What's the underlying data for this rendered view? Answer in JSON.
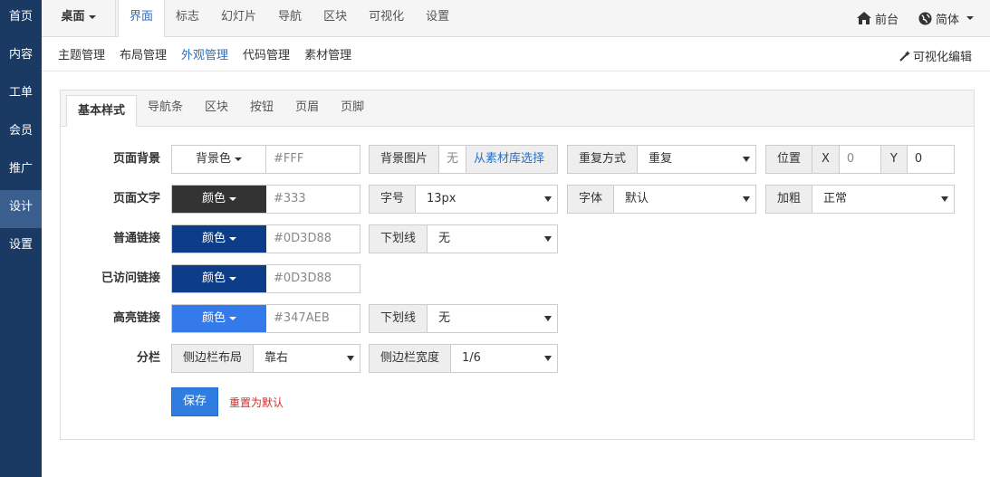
{
  "sidebar": {
    "items": [
      {
        "label": "首页"
      },
      {
        "label": "内容"
      },
      {
        "label": "工单"
      },
      {
        "label": "会员"
      },
      {
        "label": "推广"
      },
      {
        "label": "设计",
        "active": true
      },
      {
        "label": "设置"
      }
    ]
  },
  "topbar": {
    "desk": "桌面",
    "nav": [
      "界面",
      "标志",
      "幻灯片",
      "导航",
      "区块",
      "可视化",
      "设置"
    ],
    "front": "前台",
    "lang": "简体"
  },
  "subnav": {
    "items": [
      "主题管理",
      "布局管理",
      "外观管理",
      "代码管理",
      "素材管理"
    ],
    "vis_edit": "可视化编辑"
  },
  "tabs": [
    "基本样式",
    "导航条",
    "区块",
    "按钮",
    "页眉",
    "页脚"
  ],
  "form": {
    "bg": {
      "label": "页面背景",
      "btn": "背景色",
      "value": "#FFF",
      "img_label": "背景图片",
      "img_none": "无",
      "img_pick": "从素材库选择",
      "repeat_label": "重复方式",
      "repeat": "重复",
      "pos_label": "位置",
      "x": "X",
      "x_val": "0",
      "y": "Y",
      "y_val": "0"
    },
    "text": {
      "label": "页面文字",
      "btn": "颜色",
      "value": "#333",
      "size_label": "字号",
      "size": "13px",
      "font_label": "字体",
      "font": "默认",
      "bold_label": "加粗",
      "bold": "正常"
    },
    "link": {
      "label": "普通链接",
      "btn": "颜色",
      "value": "#0D3D88",
      "ul_label": "下划线",
      "ul": "无"
    },
    "visited": {
      "label": "已访问链接",
      "btn": "颜色",
      "value": "#0D3D88"
    },
    "hover": {
      "label": "高亮链接",
      "btn": "颜色",
      "value": "#347AEB",
      "ul_label": "下划线",
      "ul": "无"
    },
    "col": {
      "label": "分栏",
      "layout_label": "侧边栏布局",
      "layout": "靠右",
      "width_label": "侧边栏宽度",
      "width": "1/6"
    },
    "save": "保存",
    "reset": "重置为默认"
  },
  "colors": {
    "text_btn": "#333333",
    "link_btn": "#0D3D88",
    "hover_btn": "#347AEB",
    "sidebar": "#1b3a63"
  }
}
